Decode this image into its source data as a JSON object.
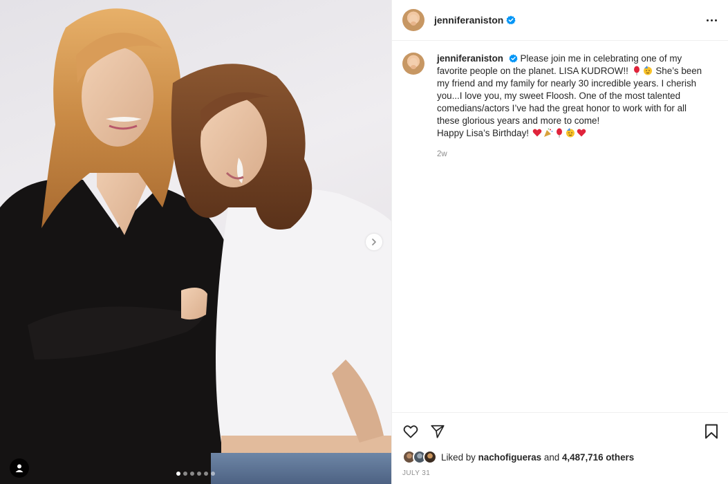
{
  "post": {
    "username": "jenniferaniston",
    "caption": {
      "username": "jenniferaniston",
      "line1": "Please join me in celebrating one of my",
      "line2": "favorite people on the planet. LISA KUDROW!!",
      "line3": "She’s been",
      "line4": "my friend and my family for nearly 30 incredible years. I cherish",
      "line5": "you...I love you, my sweet Floosh. One of the most talented",
      "line6": "comedians/actors I’ve had the great honor to work with for all",
      "line7": "these glorious years and more to come!",
      "line8": "Happy Lisa’s Birthday!"
    },
    "caption_time": "2w",
    "likes": {
      "prefix": "Liked by",
      "user": "nachofigueras",
      "joiner": "and",
      "count": "4,487,716 others"
    },
    "date": "JULY 31"
  },
  "carousel": {
    "total": 6,
    "active": 1
  },
  "icons": {
    "more": "more-options-icon",
    "like": "heart-outline-icon",
    "share": "paper-plane-icon",
    "save": "bookmark-icon",
    "next": "chevron-right-icon",
    "tags": "user-tag-icon",
    "verified": "verified-badge-icon"
  },
  "colors": {
    "verified": "#0095f6",
    "heart": "#e0243b",
    "muted": "#8e8e8e"
  }
}
